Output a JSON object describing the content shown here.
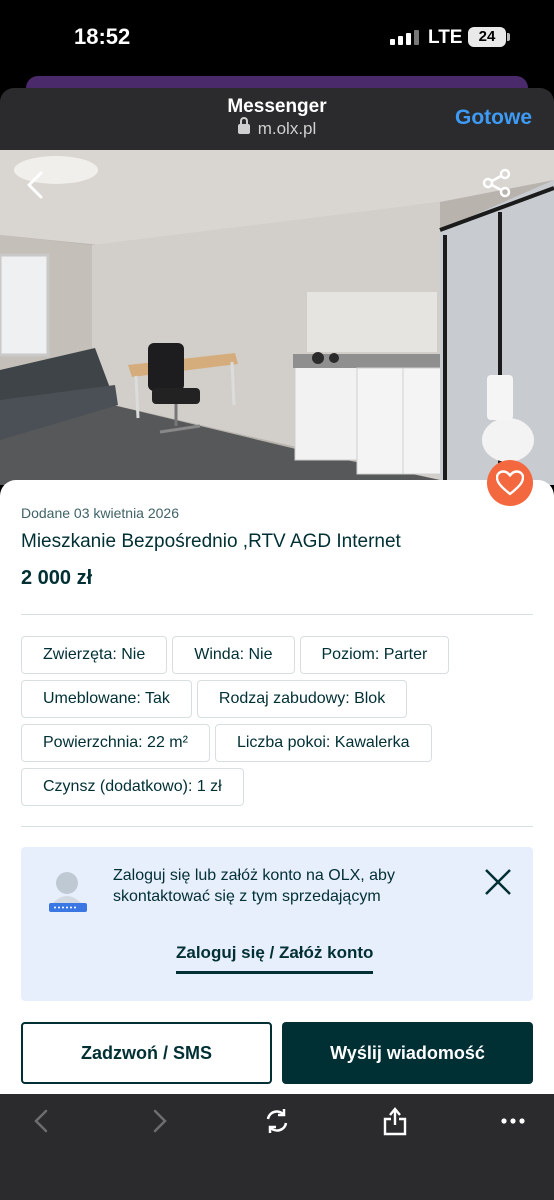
{
  "status_bar": {
    "time": "18:52",
    "network": "LTE",
    "battery": "24"
  },
  "browser_header": {
    "title": "Messenger",
    "url": "m.olx.pl",
    "done_label": "Gotowe"
  },
  "listing": {
    "added": "Dodane 03 kwietnia 2026",
    "title": "Mieszkanie Bezpośrednio ,RTV AGD Internet",
    "price": "2 000 zł",
    "params": [
      "Zwierzęta: Nie",
      "Winda: Nie",
      "Poziom: Parter",
      "Umeblowane: Tak",
      "Rodzaj zabudowy: Blok",
      "Powierzchnia: 22 m²",
      "Liczba pokoi: Kawalerka",
      "Czynsz (dodatkowo): 1 zł"
    ]
  },
  "login_prompt": {
    "message": "Zaloguj się lub załóż konto na OLX, aby skontaktować się z tym sprzedającym",
    "link": "Zaloguj się / Załóż konto"
  },
  "actions": {
    "call": "Zadzwoń / SMS",
    "message": "Wyślij wiadomość"
  },
  "colors": {
    "brand_dark": "#002f34",
    "favorite": "#f4683f",
    "link_blue": "#3d9bf5",
    "login_bg": "#e8effc"
  },
  "icons": [
    "back-icon",
    "share-icon",
    "heart-icon",
    "user-avatar-icon",
    "close-icon",
    "browser-back-icon",
    "browser-forward-icon",
    "reload-icon",
    "share-sheet-icon",
    "more-icon"
  ]
}
